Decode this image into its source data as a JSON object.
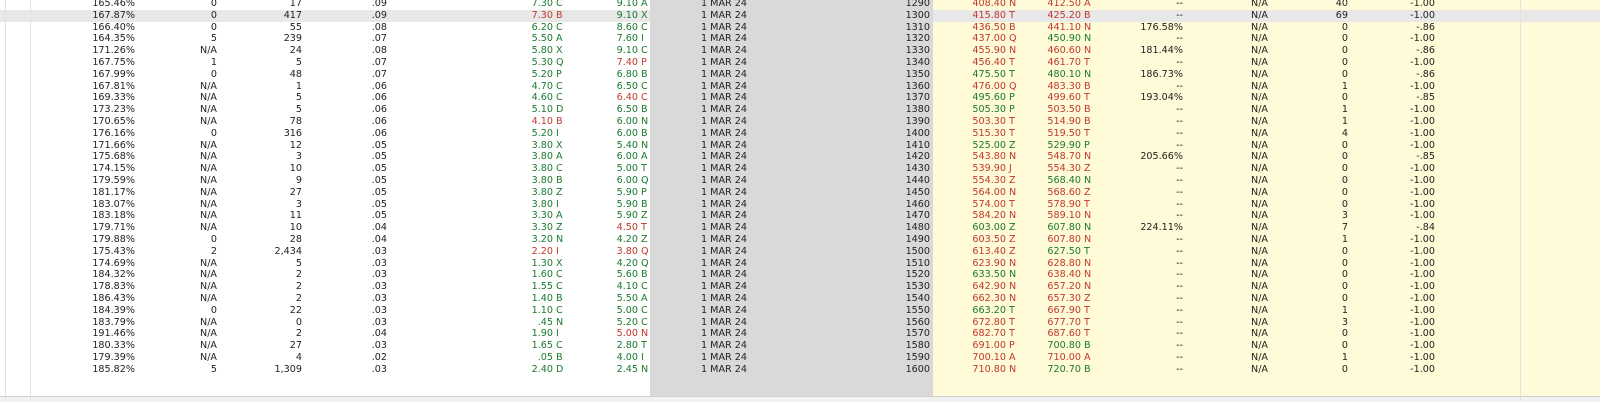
{
  "colors": {
    "bid_up": "#1a7a2e",
    "ask_dn": "#c0392b",
    "gray_column": "#d9d9d9",
    "yellow_area": "#fffbd8"
  },
  "rows": [
    {
      "iv": "165.46%",
      "chg": "0",
      "vol": "17",
      "delta": ".09",
      "bid": "7.30",
      "bid_ex": "C",
      "bid_dir": "up",
      "ask": "9.10",
      "ask_ex": "A",
      "ask_dir": "up",
      "exp": "1 MAR 24",
      "strike": "1290",
      "pbid": "408.40",
      "pbid_ex": "N",
      "pbid_dir": "dn",
      "pask": "412.50",
      "pask_ex": "A",
      "pask_dir": "dn",
      "piv": "--",
      "pchg": "N/A",
      "pvol": "40",
      "pdelta": "-1.00"
    },
    {
      "iv": "167.87%",
      "chg": "0",
      "vol": "417",
      "delta": ".09",
      "bid": "7.30",
      "bid_ex": "B",
      "bid_dir": "dn",
      "ask": "9.10",
      "ask_ex": "X",
      "ask_dir": "up",
      "exp": "1 MAR 24",
      "strike": "1300",
      "pbid": "415.80",
      "pbid_ex": "T",
      "pbid_dir": "dn",
      "pask": "425.20",
      "pask_ex": "B",
      "pask_dir": "dn",
      "piv": "--",
      "pchg": "N/A",
      "pvol": "69",
      "pdelta": "-1.00"
    },
    {
      "iv": "166.40%",
      "chg": "0",
      "vol": "55",
      "delta": ".08",
      "bid": "6.20",
      "bid_ex": "C",
      "bid_dir": "up",
      "ask": "8.60",
      "ask_ex": "C",
      "ask_dir": "up",
      "exp": "1 MAR 24",
      "strike": "1310",
      "pbid": "436.50",
      "pbid_ex": "B",
      "pbid_dir": "dn",
      "pask": "441.10",
      "pask_ex": "N",
      "pask_dir": "dn",
      "piv": "176.58%",
      "pchg": "N/A",
      "pvol": "0",
      "pdelta": "-.86"
    },
    {
      "iv": "164.35%",
      "chg": "5",
      "vol": "239",
      "delta": ".07",
      "bid": "5.50",
      "bid_ex": "A",
      "bid_dir": "up",
      "ask": "7.60",
      "ask_ex": "I",
      "ask_dir": "up",
      "exp": "1 MAR 24",
      "strike": "1320",
      "pbid": "437.00",
      "pbid_ex": "Q",
      "pbid_dir": "dn",
      "pask": "450.90",
      "pask_ex": "N",
      "pask_dir": "up",
      "piv": "--",
      "pchg": "N/A",
      "pvol": "0",
      "pdelta": "-1.00"
    },
    {
      "iv": "171.26%",
      "chg": "N/A",
      "vol": "24",
      "delta": ".08",
      "bid": "5.80",
      "bid_ex": "X",
      "bid_dir": "up",
      "ask": "9.10",
      "ask_ex": "C",
      "ask_dir": "up",
      "exp": "1 MAR 24",
      "strike": "1330",
      "pbid": "455.90",
      "pbid_ex": "N",
      "pbid_dir": "dn",
      "pask": "460.60",
      "pask_ex": "N",
      "pask_dir": "dn",
      "piv": "181.44%",
      "pchg": "N/A",
      "pvol": "0",
      "pdelta": "-.86"
    },
    {
      "iv": "167.75%",
      "chg": "1",
      "vol": "5",
      "delta": ".07",
      "bid": "5.30",
      "bid_ex": "Q",
      "bid_dir": "up",
      "ask": "7.40",
      "ask_ex": "P",
      "ask_dir": "dn",
      "exp": "1 MAR 24",
      "strike": "1340",
      "pbid": "456.40",
      "pbid_ex": "T",
      "pbid_dir": "dn",
      "pask": "461.70",
      "pask_ex": "T",
      "pask_dir": "dn",
      "piv": "--",
      "pchg": "N/A",
      "pvol": "0",
      "pdelta": "-1.00"
    },
    {
      "iv": "167.99%",
      "chg": "0",
      "vol": "48",
      "delta": ".07",
      "bid": "5.20",
      "bid_ex": "P",
      "bid_dir": "up",
      "ask": "6.80",
      "ask_ex": "B",
      "ask_dir": "up",
      "exp": "1 MAR 24",
      "strike": "1350",
      "pbid": "475.50",
      "pbid_ex": "T",
      "pbid_dir": "up",
      "pask": "480.10",
      "pask_ex": "N",
      "pask_dir": "up",
      "piv": "186.73%",
      "pchg": "N/A",
      "pvol": "0",
      "pdelta": "-.86"
    },
    {
      "iv": "167.81%",
      "chg": "N/A",
      "vol": "1",
      "delta": ".06",
      "bid": "4.70",
      "bid_ex": "C",
      "bid_dir": "up",
      "ask": "6.50",
      "ask_ex": "C",
      "ask_dir": "up",
      "exp": "1 MAR 24",
      "strike": "1360",
      "pbid": "476.00",
      "pbid_ex": "Q",
      "pbid_dir": "dn",
      "pask": "483.30",
      "pask_ex": "B",
      "pask_dir": "dn",
      "piv": "--",
      "pchg": "N/A",
      "pvol": "1",
      "pdelta": "-1.00"
    },
    {
      "iv": "169.33%",
      "chg": "N/A",
      "vol": "5",
      "delta": ".06",
      "bid": "4.60",
      "bid_ex": "C",
      "bid_dir": "up",
      "ask": "6.40",
      "ask_ex": "C",
      "ask_dir": "dn",
      "exp": "1 MAR 24",
      "strike": "1370",
      "pbid": "495.60",
      "pbid_ex": "P",
      "pbid_dir": "up",
      "pask": "499.60",
      "pask_ex": "T",
      "pask_dir": "dn",
      "piv": "193.04%",
      "pchg": "N/A",
      "pvol": "0",
      "pdelta": "-.85"
    },
    {
      "iv": "173.23%",
      "chg": "N/A",
      "vol": "5",
      "delta": ".06",
      "bid": "5.10",
      "bid_ex": "D",
      "bid_dir": "up",
      "ask": "6.50",
      "ask_ex": "B",
      "ask_dir": "up",
      "exp": "1 MAR 24",
      "strike": "1380",
      "pbid": "505.30",
      "pbid_ex": "P",
      "pbid_dir": "up",
      "pask": "503.50",
      "pask_ex": "B",
      "pask_dir": "dn",
      "piv": "--",
      "pchg": "N/A",
      "pvol": "1",
      "pdelta": "-1.00"
    },
    {
      "iv": "170.65%",
      "chg": "N/A",
      "vol": "78",
      "delta": ".06",
      "bid": "4.10",
      "bid_ex": "B",
      "bid_dir": "dn",
      "ask": "6.00",
      "ask_ex": "N",
      "ask_dir": "up",
      "exp": "1 MAR 24",
      "strike": "1390",
      "pbid": "503.30",
      "pbid_ex": "T",
      "pbid_dir": "dn",
      "pask": "514.90",
      "pask_ex": "B",
      "pask_dir": "dn",
      "piv": "--",
      "pchg": "N/A",
      "pvol": "1",
      "pdelta": "-1.00"
    },
    {
      "iv": "176.16%",
      "chg": "0",
      "vol": "316",
      "delta": ".06",
      "bid": "5.20",
      "bid_ex": "I",
      "bid_dir": "up",
      "ask": "6.00",
      "ask_ex": "B",
      "ask_dir": "up",
      "exp": "1 MAR 24",
      "strike": "1400",
      "pbid": "515.30",
      "pbid_ex": "T",
      "pbid_dir": "dn",
      "pask": "519.50",
      "pask_ex": "T",
      "pask_dir": "dn",
      "piv": "--",
      "pchg": "N/A",
      "pvol": "4",
      "pdelta": "-1.00"
    },
    {
      "iv": "171.66%",
      "chg": "N/A",
      "vol": "12",
      "delta": ".05",
      "bid": "3.80",
      "bid_ex": "X",
      "bid_dir": "up",
      "ask": "5.40",
      "ask_ex": "N",
      "ask_dir": "up",
      "exp": "1 MAR 24",
      "strike": "1410",
      "pbid": "525.00",
      "pbid_ex": "Z",
      "pbid_dir": "up",
      "pask": "529.90",
      "pask_ex": "P",
      "pask_dir": "up",
      "piv": "--",
      "pchg": "N/A",
      "pvol": "0",
      "pdelta": "-1.00"
    },
    {
      "iv": "175.68%",
      "chg": "N/A",
      "vol": "3",
      "delta": ".05",
      "bid": "3.80",
      "bid_ex": "A",
      "bid_dir": "up",
      "ask": "6.00",
      "ask_ex": "A",
      "ask_dir": "up",
      "exp": "1 MAR 24",
      "strike": "1420",
      "pbid": "543.80",
      "pbid_ex": "N",
      "pbid_dir": "dn",
      "pask": "548.70",
      "pask_ex": "N",
      "pask_dir": "dn",
      "piv": "205.66%",
      "pchg": "N/A",
      "pvol": "0",
      "pdelta": "-.85"
    },
    {
      "iv": "174.15%",
      "chg": "N/A",
      "vol": "10",
      "delta": ".05",
      "bid": "3.80",
      "bid_ex": "C",
      "bid_dir": "up",
      "ask": "5.00",
      "ask_ex": "T",
      "ask_dir": "up",
      "exp": "1 MAR 24",
      "strike": "1430",
      "pbid": "539.90",
      "pbid_ex": "J",
      "pbid_dir": "dn",
      "pask": "554.30",
      "pask_ex": "Z",
      "pask_dir": "dn",
      "piv": "--",
      "pchg": "N/A",
      "pvol": "0",
      "pdelta": "-1.00"
    },
    {
      "iv": "179.59%",
      "chg": "N/A",
      "vol": "9",
      "delta": ".05",
      "bid": "3.80",
      "bid_ex": "B",
      "bid_dir": "up",
      "ask": "6.00",
      "ask_ex": "Q",
      "ask_dir": "up",
      "exp": "1 MAR 24",
      "strike": "1440",
      "pbid": "554.30",
      "pbid_ex": "Z",
      "pbid_dir": "dn",
      "pask": "568.40",
      "pask_ex": "N",
      "pask_dir": "up",
      "piv": "--",
      "pchg": "N/A",
      "pvol": "0",
      "pdelta": "-1.00"
    },
    {
      "iv": "181.17%",
      "chg": "N/A",
      "vol": "27",
      "delta": ".05",
      "bid": "3.80",
      "bid_ex": "Z",
      "bid_dir": "up",
      "ask": "5.90",
      "ask_ex": "P",
      "ask_dir": "up",
      "exp": "1 MAR 24",
      "strike": "1450",
      "pbid": "564.00",
      "pbid_ex": "N",
      "pbid_dir": "dn",
      "pask": "568.60",
      "pask_ex": "Z",
      "pask_dir": "dn",
      "piv": "--",
      "pchg": "N/A",
      "pvol": "0",
      "pdelta": "-1.00"
    },
    {
      "iv": "183.07%",
      "chg": "N/A",
      "vol": "3",
      "delta": ".05",
      "bid": "3.80",
      "bid_ex": "I",
      "bid_dir": "up",
      "ask": "5.90",
      "ask_ex": "B",
      "ask_dir": "up",
      "exp": "1 MAR 24",
      "strike": "1460",
      "pbid": "574.00",
      "pbid_ex": "T",
      "pbid_dir": "dn",
      "pask": "578.90",
      "pask_ex": "T",
      "pask_dir": "dn",
      "piv": "--",
      "pchg": "N/A",
      "pvol": "0",
      "pdelta": "-1.00"
    },
    {
      "iv": "183.18%",
      "chg": "N/A",
      "vol": "11",
      "delta": ".05",
      "bid": "3.30",
      "bid_ex": "A",
      "bid_dir": "up",
      "ask": "5.90",
      "ask_ex": "Z",
      "ask_dir": "up",
      "exp": "1 MAR 24",
      "strike": "1470",
      "pbid": "584.20",
      "pbid_ex": "N",
      "pbid_dir": "dn",
      "pask": "589.10",
      "pask_ex": "N",
      "pask_dir": "dn",
      "piv": "--",
      "pchg": "N/A",
      "pvol": "3",
      "pdelta": "-1.00"
    },
    {
      "iv": "179.71%",
      "chg": "N/A",
      "vol": "10",
      "delta": ".04",
      "bid": "3.30",
      "bid_ex": "Z",
      "bid_dir": "up",
      "ask": "4.50",
      "ask_ex": "T",
      "ask_dir": "dn",
      "exp": "1 MAR 24",
      "strike": "1480",
      "pbid": "603.00",
      "pbid_ex": "Z",
      "pbid_dir": "up",
      "pask": "607.80",
      "pask_ex": "N",
      "pask_dir": "up",
      "piv": "224.11%",
      "pchg": "N/A",
      "pvol": "7",
      "pdelta": "-.84"
    },
    {
      "iv": "179.88%",
      "chg": "0",
      "vol": "28",
      "delta": ".04",
      "bid": "3.20",
      "bid_ex": "N",
      "bid_dir": "up",
      "ask": "4.20",
      "ask_ex": "Z",
      "ask_dir": "up",
      "exp": "1 MAR 24",
      "strike": "1490",
      "pbid": "603.50",
      "pbid_ex": "Z",
      "pbid_dir": "dn",
      "pask": "607.80",
      "pask_ex": "N",
      "pask_dir": "dn",
      "piv": "--",
      "pchg": "N/A",
      "pvol": "1",
      "pdelta": "-1.00"
    },
    {
      "iv": "175.43%",
      "chg": "2",
      "vol": "2,434",
      "delta": ".03",
      "bid": "2.20",
      "bid_ex": "I",
      "bid_dir": "dn",
      "ask": "3.80",
      "ask_ex": "Q",
      "ask_dir": "dn",
      "exp": "1 MAR 24",
      "strike": "1500",
      "pbid": "613.40",
      "pbid_ex": "Z",
      "pbid_dir": "dn",
      "pask": "627.50",
      "pask_ex": "T",
      "pask_dir": "up",
      "piv": "--",
      "pchg": "N/A",
      "pvol": "0",
      "pdelta": "-1.00"
    },
    {
      "iv": "174.69%",
      "chg": "N/A",
      "vol": "5",
      "delta": ".03",
      "bid": "1.30",
      "bid_ex": "X",
      "bid_dir": "up",
      "ask": "4.20",
      "ask_ex": "Q",
      "ask_dir": "up",
      "exp": "1 MAR 24",
      "strike": "1510",
      "pbid": "623.90",
      "pbid_ex": "N",
      "pbid_dir": "dn",
      "pask": "628.80",
      "pask_ex": "N",
      "pask_dir": "dn",
      "piv": "--",
      "pchg": "N/A",
      "pvol": "0",
      "pdelta": "-1.00"
    },
    {
      "iv": "184.32%",
      "chg": "N/A",
      "vol": "2",
      "delta": ".03",
      "bid": "1.60",
      "bid_ex": "C",
      "bid_dir": "up",
      "ask": "5.60",
      "ask_ex": "B",
      "ask_dir": "up",
      "exp": "1 MAR 24",
      "strike": "1520",
      "pbid": "633.50",
      "pbid_ex": "N",
      "pbid_dir": "up",
      "pask": "638.40",
      "pask_ex": "N",
      "pask_dir": "dn",
      "piv": "--",
      "pchg": "N/A",
      "pvol": "0",
      "pdelta": "-1.00"
    },
    {
      "iv": "178.83%",
      "chg": "N/A",
      "vol": "2",
      "delta": ".03",
      "bid": "1.55",
      "bid_ex": "C",
      "bid_dir": "up",
      "ask": "4.10",
      "ask_ex": "C",
      "ask_dir": "up",
      "exp": "1 MAR 24",
      "strike": "1530",
      "pbid": "642.90",
      "pbid_ex": "N",
      "pbid_dir": "dn",
      "pask": "657.20",
      "pask_ex": "N",
      "pask_dir": "dn",
      "piv": "--",
      "pchg": "N/A",
      "pvol": "0",
      "pdelta": "-1.00"
    },
    {
      "iv": "186.43%",
      "chg": "N/A",
      "vol": "2",
      "delta": ".03",
      "bid": "1.40",
      "bid_ex": "B",
      "bid_dir": "up",
      "ask": "5.50",
      "ask_ex": "A",
      "ask_dir": "up",
      "exp": "1 MAR 24",
      "strike": "1540",
      "pbid": "662.30",
      "pbid_ex": "N",
      "pbid_dir": "dn",
      "pask": "657.30",
      "pask_ex": "Z",
      "pask_dir": "dn",
      "piv": "--",
      "pchg": "N/A",
      "pvol": "0",
      "pdelta": "-1.00"
    },
    {
      "iv": "184.39%",
      "chg": "0",
      "vol": "22",
      "delta": ".03",
      "bid": "1.10",
      "bid_ex": "C",
      "bid_dir": "up",
      "ask": "5.00",
      "ask_ex": "C",
      "ask_dir": "up",
      "exp": "1 MAR 24",
      "strike": "1550",
      "pbid": "663.20",
      "pbid_ex": "T",
      "pbid_dir": "up",
      "pask": "667.90",
      "pask_ex": "T",
      "pask_dir": "dn",
      "piv": "--",
      "pchg": "N/A",
      "pvol": "1",
      "pdelta": "-1.00"
    },
    {
      "iv": "183.79%",
      "chg": "N/A",
      "vol": "0",
      "delta": ".03",
      "bid": ".45",
      "bid_ex": "N",
      "bid_dir": "up",
      "ask": "5.20",
      "ask_ex": "C",
      "ask_dir": "up",
      "exp": "1 MAR 24",
      "strike": "1560",
      "pbid": "672.80",
      "pbid_ex": "T",
      "pbid_dir": "dn",
      "pask": "677.70",
      "pask_ex": "T",
      "pask_dir": "dn",
      "piv": "--",
      "pchg": "N/A",
      "pvol": "3",
      "pdelta": "-1.00"
    },
    {
      "iv": "191.46%",
      "chg": "N/A",
      "vol": "2",
      "delta": ".04",
      "bid": "1.90",
      "bid_ex": "I",
      "bid_dir": "up",
      "ask": "5.00",
      "ask_ex": "N",
      "ask_dir": "dn",
      "exp": "1 MAR 24",
      "strike": "1570",
      "pbid": "682.70",
      "pbid_ex": "T",
      "pbid_dir": "dn",
      "pask": "687.60",
      "pask_ex": "T",
      "pask_dir": "dn",
      "piv": "--",
      "pchg": "N/A",
      "pvol": "0",
      "pdelta": "-1.00"
    },
    {
      "iv": "180.33%",
      "chg": "N/A",
      "vol": "27",
      "delta": ".03",
      "bid": "1.65",
      "bid_ex": "C",
      "bid_dir": "up",
      "ask": "2.80",
      "ask_ex": "T",
      "ask_dir": "up",
      "exp": "1 MAR 24",
      "strike": "1580",
      "pbid": "691.00",
      "pbid_ex": "P",
      "pbid_dir": "dn",
      "pask": "700.80",
      "pask_ex": "B",
      "pask_dir": "up",
      "piv": "--",
      "pchg": "N/A",
      "pvol": "0",
      "pdelta": "-1.00"
    },
    {
      "iv": "179.39%",
      "chg": "N/A",
      "vol": "4",
      "delta": ".02",
      "bid": ".05",
      "bid_ex": "B",
      "bid_dir": "up",
      "ask": "4.00",
      "ask_ex": "I",
      "ask_dir": "up",
      "exp": "1 MAR 24",
      "strike": "1590",
      "pbid": "700.10",
      "pbid_ex": "A",
      "pbid_dir": "dn",
      "pask": "710.00",
      "pask_ex": "A",
      "pask_dir": "dn",
      "piv": "--",
      "pchg": "N/A",
      "pvol": "1",
      "pdelta": "-1.00"
    },
    {
      "iv": "185.82%",
      "chg": "5",
      "vol": "1,309",
      "delta": ".03",
      "bid": "2.40",
      "bid_ex": "D",
      "bid_dir": "up",
      "ask": "2.45",
      "ask_ex": "N",
      "ask_dir": "up",
      "exp": "1 MAR 24",
      "strike": "1600",
      "pbid": "710.80",
      "pbid_ex": "N",
      "pbid_dir": "dn",
      "pask": "720.70",
      "pask_ex": "B",
      "pask_dir": "up",
      "piv": "--",
      "pchg": "N/A",
      "pvol": "0",
      "pdelta": "-1.00"
    }
  ]
}
